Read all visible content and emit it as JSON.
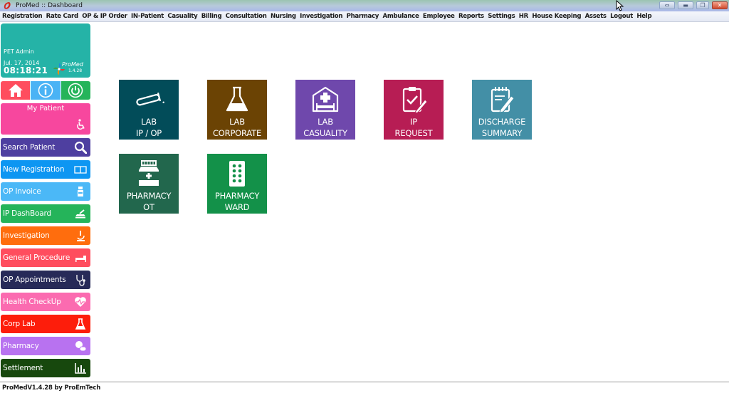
{
  "window": {
    "title": "ProMed :: Dashboard",
    "controls": [
      "resize-icon",
      "minimize-icon",
      "restore-icon",
      "close-icon"
    ]
  },
  "menubar": {
    "items": [
      "Registration",
      "Rate Card",
      "OP & IP Order",
      "IN-Patient",
      "Casuality",
      "Billing",
      "Consultation",
      "Nursing",
      "Investigation",
      "Pharmacy",
      "Ambulance",
      "Employee",
      "Reports",
      "Settings",
      "HR",
      "House Keeping",
      "Assets",
      "Logout",
      "Help"
    ]
  },
  "profile": {
    "user": "PET Admin",
    "date": "Jul. 17, 2014",
    "time": "08:18:21",
    "brand": "ProMed",
    "version": "1.4.28",
    "color": "#25b3a7"
  },
  "quick_actions": [
    {
      "icon": "home-icon",
      "color": "#ff4d5e"
    },
    {
      "icon": "info-icon",
      "color": "#4ab3f5"
    },
    {
      "icon": "power-icon",
      "color": "#25b45a"
    }
  ],
  "my_patient": {
    "label": "My Patient",
    "icon": "wheelchair-icon",
    "color": "#f7479e"
  },
  "nav": [
    {
      "label": "Search Patient",
      "icon": "search-icon",
      "color": "#4e3fa0"
    },
    {
      "label": "New Registration",
      "icon": "book-icon",
      "color": "#0d96f2"
    },
    {
      "label": "OP Invoice",
      "icon": "bottle-icon",
      "color": "#4bb8f7"
    },
    {
      "label": "IP DashBoard",
      "icon": "stretcher-icon",
      "color": "#25b45a"
    },
    {
      "label": "Investigation",
      "icon": "microscope-icon",
      "color": "#ff6d0d"
    },
    {
      "label": "General Procedure",
      "icon": "bed-icon",
      "color": "#ff4d5e"
    },
    {
      "label": "OP Appointments",
      "icon": "stethoscope-icon",
      "color": "#272a58"
    },
    {
      "label": "Health CheckUp",
      "icon": "heart-icon",
      "color": "#fb6bb0"
    },
    {
      "label": "Corp Lab",
      "icon": "flask-icon",
      "color": "#fd1d0b"
    },
    {
      "label": "Pharmacy",
      "icon": "pills-icon",
      "color": "#b872f0"
    },
    {
      "label": "Settlement",
      "icon": "bar-chart-icon",
      "color": "#17480d"
    }
  ],
  "tiles": [
    {
      "line1": "LAB",
      "line2": "IP / OP",
      "icon": "test-tube-icon",
      "color": "#024c59"
    },
    {
      "line1": "LAB",
      "line2": "CORPORATE",
      "icon": "flask-icon",
      "color": "#6b4304"
    },
    {
      "line1": "LAB",
      "line2": "CASUALITY",
      "icon": "hospital-bed-icon",
      "color": "#6f48ac"
    },
    {
      "line1": "IP",
      "line2": "REQUEST",
      "icon": "clipboard-check-icon",
      "color": "#b71d54"
    },
    {
      "line1": "DISCHARGE",
      "line2": "SUMMARY",
      "icon": "notepad-pencil-icon",
      "color": "#438fa6"
    },
    {
      "line1": "PHARMACY",
      "line2": "OT",
      "icon": "medicine-jar-icon",
      "color": "#22674d"
    },
    {
      "line1": "PHARMACY",
      "line2": "WARD",
      "icon": "pill-pack-icon",
      "color": "#139149"
    }
  ],
  "statusbar": {
    "text": "ProMedV1.4.28 by ProEmTech"
  }
}
